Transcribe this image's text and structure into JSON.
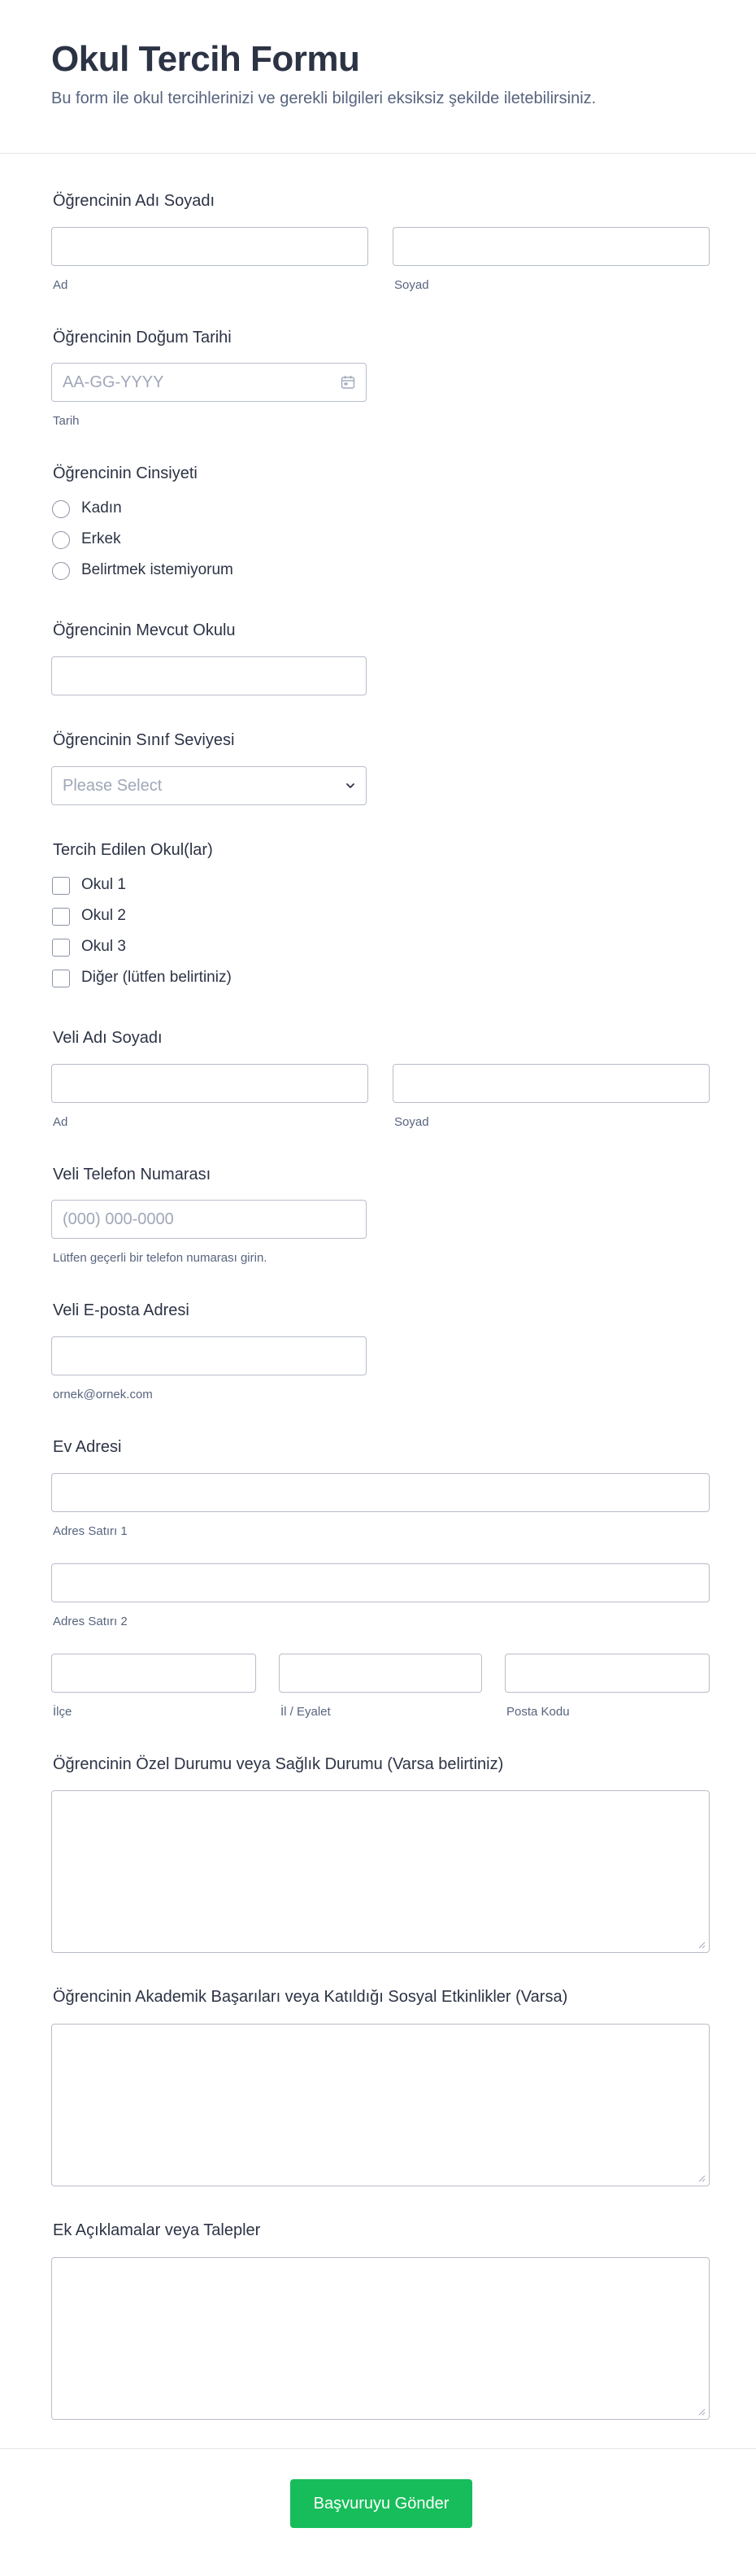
{
  "form": {
    "title": "Okul Tercih Formu",
    "subtitle": "Bu form ile okul tercihlerinizi ve gerekli bilgileri eksiksiz şekilde iletebilirsiniz."
  },
  "student_name": {
    "label": "Öğrencinin Adı Soyadı",
    "first_sub": "Ad",
    "last_sub": "Soyad"
  },
  "birth_date": {
    "label": "Öğrencinin Doğum Tarihi",
    "placeholder": "AA-GG-YYYY",
    "sub": "Tarih"
  },
  "gender": {
    "label": "Öğrencinin Cinsiyeti",
    "options": [
      "Kadın",
      "Erkek",
      "Belirtmek istemiyorum"
    ]
  },
  "current_school": {
    "label": "Öğrencinin Mevcut Okulu"
  },
  "grade_level": {
    "label": "Öğrencinin Sınıf Seviyesi",
    "selected": "Please Select"
  },
  "preferred_schools": {
    "label": "Tercih Edilen Okul(lar)",
    "options": [
      "Okul 1",
      "Okul 2",
      "Okul 3",
      "Diğer (lütfen belirtiniz)"
    ]
  },
  "parent_name": {
    "label": "Veli Adı Soyadı",
    "first_sub": "Ad",
    "last_sub": "Soyad"
  },
  "parent_phone": {
    "label": "Veli Telefon Numarası",
    "placeholder": "(000) 000-0000",
    "sub": "Lütfen geçerli bir telefon numarası girin."
  },
  "parent_email": {
    "label": "Veli E-posta Adresi",
    "sub": "ornek@ornek.com"
  },
  "address": {
    "label": "Ev Adresi",
    "line1_sub": "Adres Satırı 1",
    "line2_sub": "Adres Satırı 2",
    "district_sub": "İlçe",
    "province_sub": "İl / Eyalet",
    "postal_sub": "Posta Kodu"
  },
  "special_condition": {
    "label": "Öğrencinin Özel Durumu veya Sağlık Durumu (Varsa belirtiniz)"
  },
  "achievements": {
    "label": "Öğrencinin Akademik Başarıları veya Katıldığı Sosyal Etkinlikler (Varsa)"
  },
  "extra_notes": {
    "label": "Ek Açıklamalar veya Talepler"
  },
  "submit_label": "Başvuruyu Gönder",
  "icons": {
    "calendar": "calendar-icon",
    "dropdown": "chevron-down-icon"
  },
  "colors": {
    "submit": "#18bd5b",
    "text": "#2c3345",
    "sublabel": "#57647e",
    "border": "#b8bdc9"
  }
}
